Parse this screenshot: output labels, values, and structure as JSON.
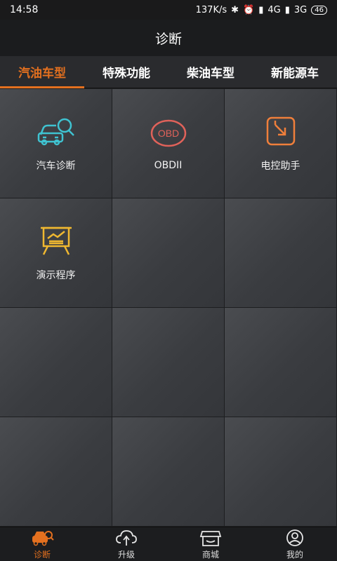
{
  "status": {
    "time": "14:58",
    "speed": "137K/s",
    "net1": "4G",
    "net2": "3G",
    "battery": "46"
  },
  "header": {
    "title": "诊断"
  },
  "tabs": [
    {
      "label": "汽油车型",
      "active": true
    },
    {
      "label": "特殊功能",
      "active": false
    },
    {
      "label": "柴油车型",
      "active": false
    },
    {
      "label": "新能源车",
      "active": false
    }
  ],
  "grid": {
    "items": [
      {
        "label": "汽车诊断",
        "icon": "car-search-icon"
      },
      {
        "label": "OBDII",
        "icon": "obd-icon",
        "icon_text": "OBD"
      },
      {
        "label": "电控助手",
        "icon": "ecu-assistant-icon"
      },
      {
        "label": "演示程序",
        "icon": "demo-presentation-icon"
      }
    ]
  },
  "bottom_nav": [
    {
      "label": "诊断",
      "icon": "car-diagnose-icon",
      "active": true
    },
    {
      "label": "升级",
      "icon": "cloud-upgrade-icon",
      "active": false
    },
    {
      "label": "商城",
      "icon": "shop-icon",
      "active": false
    },
    {
      "label": "我的",
      "icon": "user-icon",
      "active": false
    }
  ],
  "colors": {
    "accent": "#e3701f",
    "teal": "#3fc3d1",
    "obd_red": "#e0625a",
    "ecu_orange": "#f07f3b",
    "demo_yellow": "#f0b830"
  }
}
